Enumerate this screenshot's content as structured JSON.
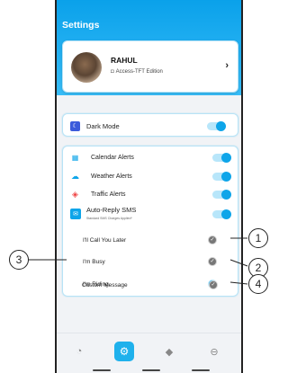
{
  "header": {
    "title": "Settings"
  },
  "profile": {
    "name": "RAHUL",
    "edition": "Access-TFT Edition",
    "chevron": "›"
  },
  "dark_mode": {
    "label": "Dark Mode",
    "enabled": true
  },
  "alerts": [
    {
      "label": "Calendar Alerts",
      "icon": "calendar-icon",
      "icon_color": "#0ea5e9",
      "enabled": true
    },
    {
      "label": "Weather Alerts",
      "icon": "cloud-icon",
      "icon_color": "#0ea5e9",
      "enabled": true
    },
    {
      "label": "Traffic Alerts",
      "icon": "car-icon",
      "icon_color": "#ef4444",
      "enabled": true
    }
  ],
  "auto_reply": {
    "label": "Auto-Reply SMS",
    "sublabel": "Standard SMS Charges Applied*",
    "enabled": true,
    "options": [
      {
        "label": "I'll Call You Later",
        "selected": false
      },
      {
        "label": "I'm Busy",
        "selected": false
      },
      {
        "label": "I'm Riding",
        "selected": true
      },
      {
        "label": "Custom Message",
        "selected": false
      }
    ]
  },
  "bottom_nav": [
    {
      "name": "speedometer-icon",
      "active": false
    },
    {
      "name": "settings-icon",
      "active": true
    },
    {
      "name": "navigation-icon",
      "active": false
    },
    {
      "name": "minus-circle-icon",
      "active": false
    }
  ],
  "callouts": [
    "1",
    "2",
    "3",
    "4"
  ],
  "colors": {
    "accent": "#0ea5e9",
    "header": "#0aa1ea",
    "background": "#f1f3f6"
  }
}
